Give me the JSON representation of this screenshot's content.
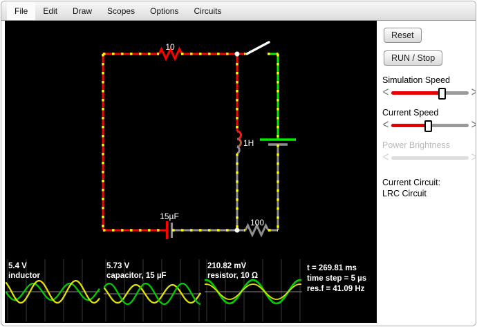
{
  "menu": {
    "items": [
      "File",
      "Edit",
      "Draw",
      "Scopes",
      "Options",
      "Circuits"
    ]
  },
  "colors": {
    "wire_hot": "#ff0000",
    "wire_neutral": "#8f8f8f",
    "wire_pos": "#00ee00",
    "current_dot": "#ffff00",
    "node": "#ffffff",
    "switch_blade": "#ffffff",
    "accent": "#e60000",
    "scope_green": "#00cc00",
    "scope_yellow": "#e2e200"
  },
  "circuit": {
    "labels": {
      "top_resistor": "10",
      "inductor": "1H",
      "capacitor": "15µF",
      "bottom_resistor": "100"
    }
  },
  "scopes": [
    {
      "value": "5.4 V",
      "label": "inductor",
      "center": 47,
      "waves": [
        {
          "color": "#00cc00",
          "amp": -12,
          "phase": 40,
          "period": 53,
          "width": 2.3
        },
        {
          "color": "#e2e200",
          "amp": 16,
          "phase": 22,
          "period": 53,
          "width": 2.3
        }
      ]
    },
    {
      "value": "5.73 V",
      "label": "capacitor, 15 µF",
      "center": 50,
      "waves": [
        {
          "color": "#e2e200",
          "amp": 13,
          "phase": 20,
          "period": 53,
          "width": 2.3
        },
        {
          "color": "#00cc00",
          "amp": -15,
          "phase": 8,
          "period": 53,
          "width": 2.3
        }
      ]
    },
    {
      "value": "210.82 mV",
      "label": "resistor, 10 Ω",
      "center": 47,
      "waves": [
        {
          "color": "#00cc00",
          "amp": -17,
          "phase": 2,
          "period": 68,
          "width": 2.8
        },
        {
          "color": "#e2e200",
          "amp": -11,
          "phase": 2,
          "period": 68,
          "width": 1.8
        }
      ]
    }
  ],
  "status": {
    "time": "t = 269.81 ms",
    "step": "time step = 5 µs",
    "resf": "res.f = 41.09 Hz"
  },
  "sidebar": {
    "reset_label": "Reset",
    "run_label": "RUN / Stop",
    "sim_speed": {
      "label": "Simulation Speed",
      "fill": 0.65
    },
    "current_speed": {
      "label": "Current Speed",
      "fill": 0.47
    },
    "power": {
      "label": "Power Brightness"
    },
    "current_circuit_label": "Current Circuit:",
    "current_circuit_value": "LRC Circuit"
  }
}
